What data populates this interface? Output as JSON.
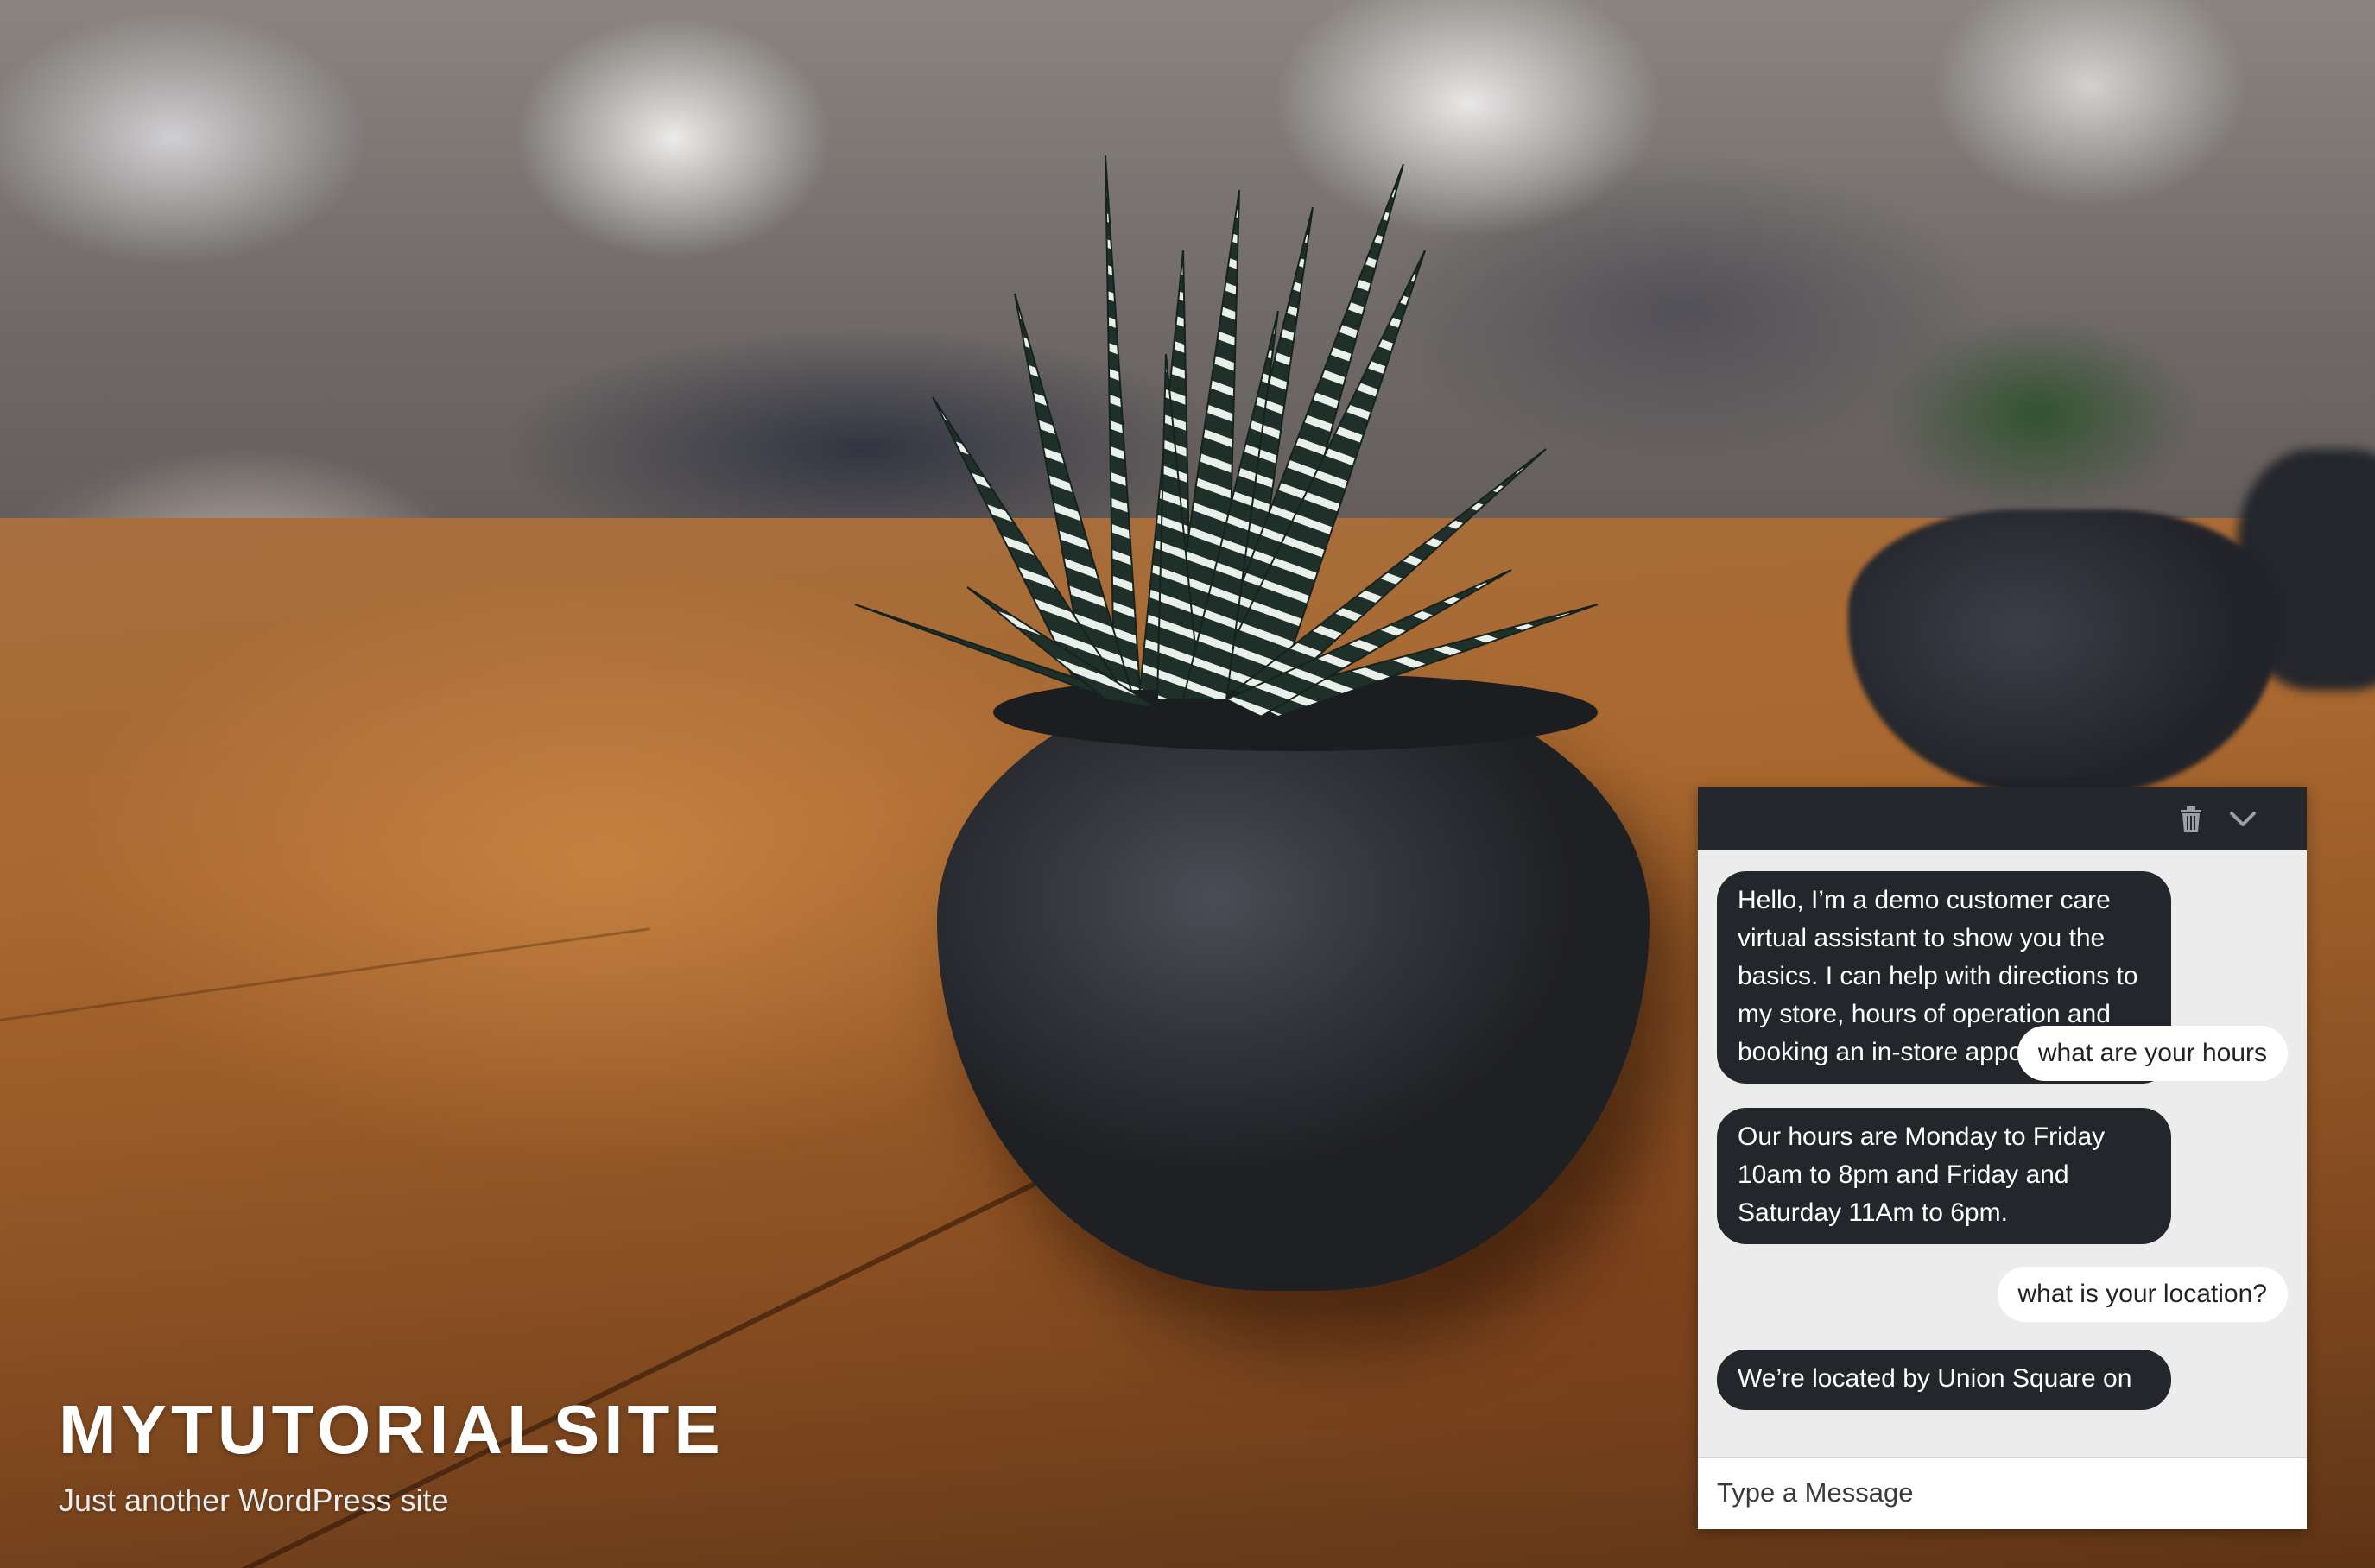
{
  "site": {
    "title": "MYTUTORIALSITE",
    "tagline": "Just another WordPress site"
  },
  "hero": {
    "image_subject": "zebra succulent in dark pot on wooden table"
  },
  "chat": {
    "header_icons": [
      "trash-icon",
      "chevron-down-icon"
    ],
    "header_color": "#23272b",
    "messages": [
      {
        "from": "bot",
        "text": "Hello, I’m a demo customer care virtual assistant to show you the basics. I can help with directions to my store, hours of operation and booking an in-store appointment"
      },
      {
        "from": "user",
        "text": "what are your hours"
      },
      {
        "from": "bot",
        "text": "Our hours are Monday to Friday 10am to 8pm and Friday and Saturday 11Am to 6pm."
      },
      {
        "from": "user",
        "text": "what is your location?"
      },
      {
        "from": "bot",
        "text": "We’re located by Union Square on"
      }
    ],
    "input": {
      "placeholder": "Type a Message",
      "value": ""
    }
  }
}
